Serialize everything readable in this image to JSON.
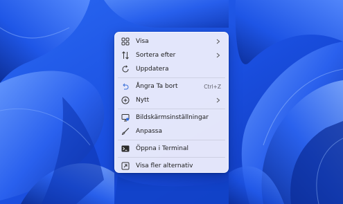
{
  "wallpaper": {
    "base_color": "#1c57e6",
    "accent_color": "#3f7cff",
    "dark_color": "#0a2d9c"
  },
  "context_menu": {
    "items": [
      {
        "label": "Visa",
        "icon": "grid-icon",
        "submenu": true
      },
      {
        "label": "Sortera efter",
        "icon": "sort-icon",
        "submenu": true
      },
      {
        "label": "Uppdatera",
        "icon": "refresh-icon",
        "submenu": false
      },
      {
        "label": "Ångra Ta bort",
        "icon": "undo-icon",
        "shortcut": "Ctrl+Z",
        "submenu": false
      },
      {
        "label": "Nytt",
        "icon": "new-plus-icon",
        "submenu": true
      },
      {
        "label": "Bildskärmsinställningar",
        "icon": "display-icon",
        "submenu": false
      },
      {
        "label": "Anpassa",
        "icon": "brush-icon",
        "submenu": false
      },
      {
        "label": "Öppna i Terminal",
        "icon": "terminal-icon",
        "submenu": false
      },
      {
        "label": "Visa fler alternativ",
        "icon": "more-options-icon",
        "submenu": false
      }
    ]
  }
}
